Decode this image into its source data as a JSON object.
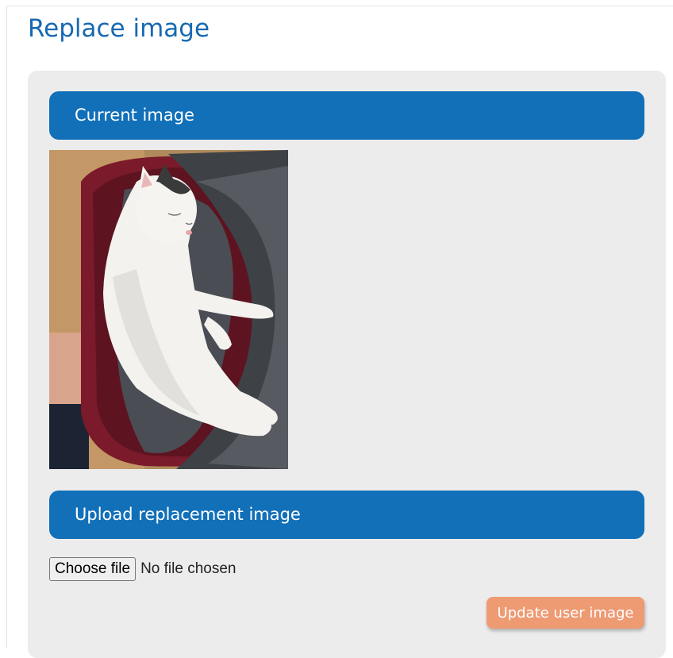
{
  "page": {
    "title": "Replace image"
  },
  "sections": {
    "current": {
      "header": "Current image"
    },
    "upload": {
      "header": "Upload replacement image"
    }
  },
  "file_input": {
    "button_label": "Choose file",
    "status": "No file chosen"
  },
  "actions": {
    "update_label": "Update user image"
  },
  "colors": {
    "title": "#1769b1",
    "header_bg": "#1270b9",
    "panel_bg": "#ececec",
    "update_button_bg": "#ee9a73"
  }
}
